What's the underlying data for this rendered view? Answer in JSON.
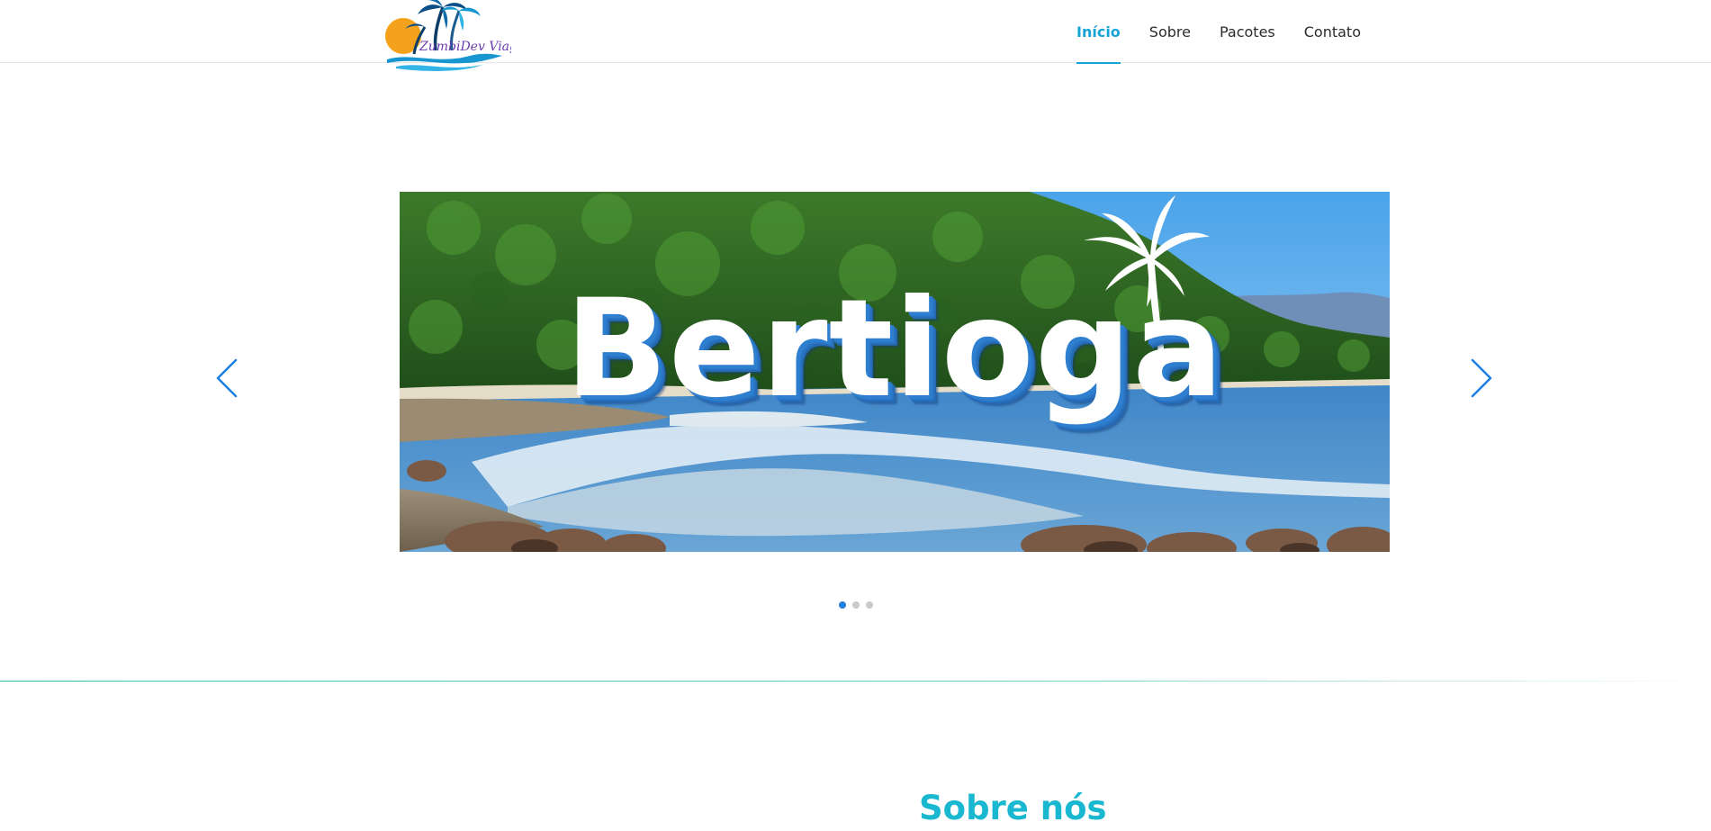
{
  "header": {
    "logo_text": "ZumbiDev Viagens",
    "nav": [
      {
        "label": "Início",
        "active": true
      },
      {
        "label": "Sobre",
        "active": false
      },
      {
        "label": "Pacotes",
        "active": false
      },
      {
        "label": "Contato",
        "active": false
      }
    ]
  },
  "slider": {
    "slide_title": "Bertioga",
    "prev_icon": "chevron-left-icon",
    "next_icon": "chevron-right-icon",
    "dots_count": 3,
    "active_dot": 0
  },
  "about": {
    "title": "Sobre nós"
  },
  "colors": {
    "accent": "#16a3d6",
    "slider_arrow": "#1e7fe0",
    "about_title": "#19b7d0"
  }
}
